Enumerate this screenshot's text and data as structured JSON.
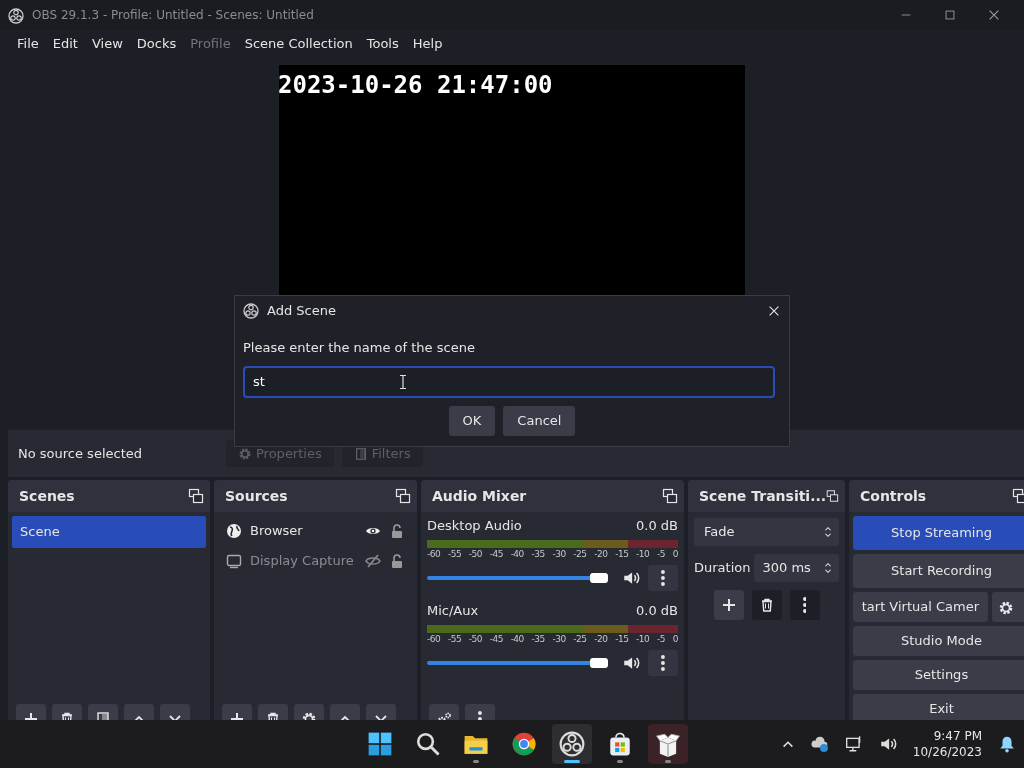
{
  "window": {
    "title": "OBS 29.1.3 - Profile: Untitled - Scenes: Untitled"
  },
  "menu": [
    {
      "label": "File",
      "disabled": false
    },
    {
      "label": "Edit",
      "disabled": false
    },
    {
      "label": "View",
      "disabled": false
    },
    {
      "label": "Docks",
      "disabled": false
    },
    {
      "label": "Profile",
      "disabled": true
    },
    {
      "label": "Scene Collection",
      "disabled": false
    },
    {
      "label": "Tools",
      "disabled": false
    },
    {
      "label": "Help",
      "disabled": false
    }
  ],
  "preview": {
    "timestamp": "2023-10-26 21:47:00"
  },
  "source_toolbar": {
    "status": "No source selected",
    "buttons": [
      {
        "label": "Properties",
        "kind": "gear",
        "disabled": true
      },
      {
        "label": "Filters",
        "kind": "filter",
        "disabled": true
      }
    ]
  },
  "scenes": {
    "title": "Scenes",
    "items": [
      {
        "label": "Scene",
        "selected": true
      }
    ]
  },
  "sources": {
    "title": "Sources",
    "items": [
      {
        "label": "Browser",
        "kind": "browser",
        "visible": true,
        "locked": false
      },
      {
        "label": "Display Capture",
        "kind": "display",
        "visible": false,
        "locked": false
      }
    ]
  },
  "audio_mixer": {
    "title": "Audio Mixer",
    "channels": [
      {
        "name": "Desktop Audio",
        "reading": "0.0 dB",
        "level": 0.97,
        "muted": false,
        "scale": [
          "-60",
          "-55",
          "-50",
          "-45",
          "-40",
          "-35",
          "-30",
          "-25",
          "-20",
          "-15",
          "-10",
          "-5",
          "0"
        ]
      },
      {
        "name": "Mic/Aux",
        "reading": "0.0 dB",
        "level": 0.97,
        "muted": false,
        "scale": [
          "-60",
          "-55",
          "-50",
          "-45",
          "-40",
          "-35",
          "-30",
          "-25",
          "-20",
          "-15",
          "-10",
          "-5",
          "0"
        ]
      }
    ]
  },
  "scene_transitions": {
    "title": "Scene Transiti...",
    "transition": "Fade",
    "duration_label": "Duration",
    "duration": "300 ms"
  },
  "controls": {
    "title": "Controls",
    "buttons": [
      {
        "label": "Stop Streaming",
        "active": true
      },
      {
        "label": "Start Recording",
        "active": false
      },
      {
        "label": "tart Virtual Camer",
        "active": false
      },
      {
        "label": "Studio Mode",
        "active": false
      },
      {
        "label": "Settings",
        "active": false
      },
      {
        "label": "Exit",
        "active": false
      }
    ]
  },
  "dialog": {
    "title": "Add Scene",
    "prompt": "Please enter the name of the scene",
    "value": "st",
    "buttons": [
      "OK",
      "Cancel"
    ]
  },
  "taskbar": {
    "apps": [
      {
        "kind": "start",
        "active": false,
        "running": false
      },
      {
        "kind": "search",
        "active": false,
        "running": false
      },
      {
        "kind": "folder",
        "active": false,
        "running": true
      },
      {
        "kind": "browser",
        "active": false,
        "running": false
      },
      {
        "kind": "obs",
        "active": true,
        "running": true
      },
      {
        "kind": "store",
        "active": false,
        "running": true
      },
      {
        "kind": "package",
        "active": false,
        "running": true
      }
    ],
    "time": "9:47 PM",
    "date": "10/26/2023"
  }
}
